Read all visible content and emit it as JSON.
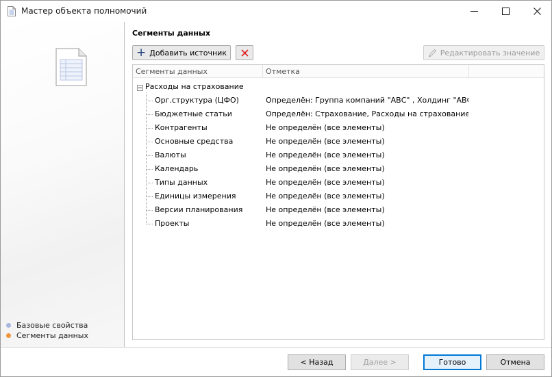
{
  "window": {
    "title": "Мастер объекта полномочий"
  },
  "steps": [
    {
      "label": "Базовые свойства",
      "color": "#a9b6e0"
    },
    {
      "label": "Сегменты данных",
      "color": "#f0963c"
    }
  ],
  "section": {
    "title": "Сегменты данных"
  },
  "toolbar": {
    "add_label": "Добавить источник",
    "edit_label": "Редактировать значение"
  },
  "grid": {
    "columns": [
      "Сегменты данных",
      "Отметка"
    ],
    "root_label": "Расходы на страхование",
    "rows": [
      {
        "name": "Орг.структура (ЦФО)",
        "mark": "Определён: Группа компаний \"АВС\" , Холдинг \"АВС-Машиностроение\""
      },
      {
        "name": "Бюджетные статьи",
        "mark": "Определён: Страхование, Расходы на страхование, Обязательства"
      },
      {
        "name": "Контрагенты",
        "mark": "Не определён (все элементы)"
      },
      {
        "name": "Основные средства",
        "mark": "Не определён (все элементы)"
      },
      {
        "name": "Валюты",
        "mark": "Не определён (все элементы)"
      },
      {
        "name": "Календарь",
        "mark": "Не определён (все элементы)"
      },
      {
        "name": "Типы данных",
        "mark": "Не определён (все элементы)"
      },
      {
        "name": "Единицы измерения",
        "mark": "Не определён (все элементы)"
      },
      {
        "name": "Версии планирования",
        "mark": "Не определён (все элементы)"
      },
      {
        "name": "Проекты",
        "mark": "Не определён (все элементы)"
      }
    ]
  },
  "footer": {
    "back_label": "< Назад",
    "next_label": "Далее >",
    "done_label": "Готово",
    "cancel_label": "Отмена"
  },
  "colors": {
    "accent": "#0078d7",
    "delete": "#e02020"
  }
}
